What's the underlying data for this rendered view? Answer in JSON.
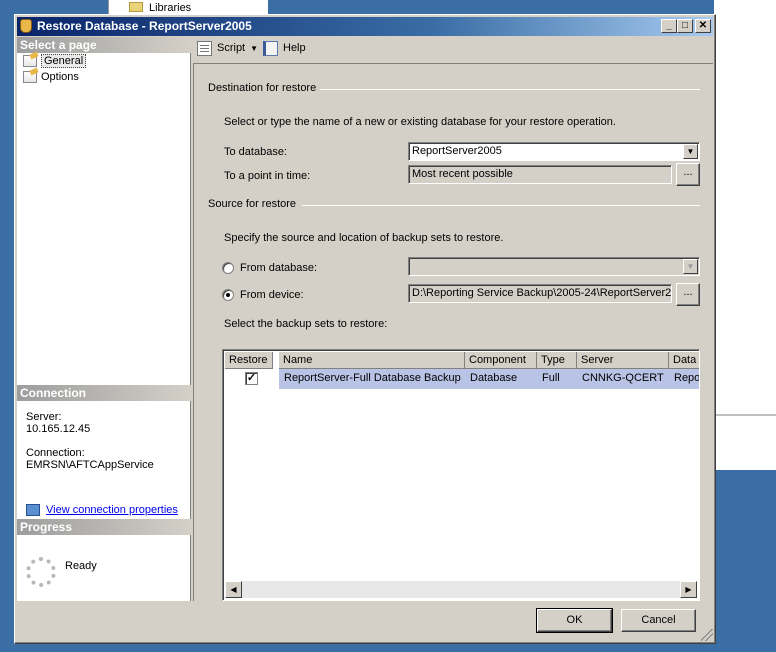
{
  "background": {
    "libraries_label": "Libraries"
  },
  "dialog": {
    "title": "Restore Database - ReportServer2005",
    "window_buttons": {
      "minimize": "_",
      "maximize": "□",
      "close": "✕"
    }
  },
  "left_panel": {
    "select_page_header": "Select a page",
    "pages": [
      {
        "label": "General",
        "selected": true
      },
      {
        "label": "Options",
        "selected": false
      }
    ],
    "connection_header": "Connection",
    "server_label": "Server:",
    "server_value": "10.165.12.45",
    "connection_label": "Connection:",
    "connection_value": "EMRSN\\AFTCAppService",
    "view_connection_link": "View connection properties",
    "progress_header": "Progress",
    "progress_status": "Ready"
  },
  "toolbar": {
    "script_label": "Script",
    "help_label": "Help"
  },
  "destination": {
    "group_label": "Destination for restore",
    "description": "Select or type the name of a new or existing database for your restore operation.",
    "to_database_label": "To database:",
    "to_database_value": "ReportServer2005",
    "to_point_label": "To a point in time:",
    "to_point_value": "Most recent possible",
    "ellipsis": "..."
  },
  "source": {
    "group_label": "Source for restore",
    "description": "Specify the source and location of backup sets to restore.",
    "from_database_label": "From database:",
    "from_database_value": "",
    "from_device_label": "From device:",
    "from_device_value": "D:\\Reporting Service Backup\\2005-24\\ReportServer2",
    "ellipsis": "...",
    "selected_option": "From device"
  },
  "backup_sets": {
    "label": "Select the backup sets to restore:",
    "columns": [
      "Restore",
      "Name",
      "Component",
      "Type",
      "Server",
      "Data"
    ],
    "rows": [
      {
        "restore": true,
        "restore_mark": "✓",
        "name": "ReportServer-Full Database Backup",
        "component": "Database",
        "type": "Full",
        "server": "CNNKG-QCERT",
        "data": "Repo"
      }
    ]
  },
  "buttons": {
    "ok": "OK",
    "cancel": "Cancel"
  },
  "colors": {
    "desktop": "#3a6ea5",
    "dialog_face": "#d4d0c8",
    "title_gradient_start": "#0a246a",
    "selected_row": "#b9c3e6"
  }
}
